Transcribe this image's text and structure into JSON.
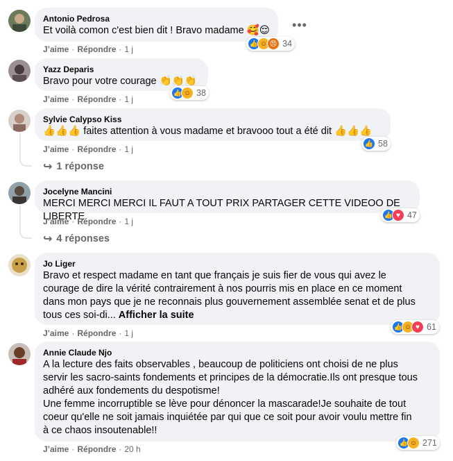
{
  "comments": [
    {
      "author": "Antonio Pedrosa",
      "text": "Et voilà comon c'est bien dit ! Bravo madame 🥰😌",
      "like_label": "J’aime",
      "reply_label": "Répondre",
      "time": "1 j",
      "reactions": [
        "like-icon",
        "care-icon",
        "angry-icon"
      ],
      "count": "34"
    },
    {
      "author": "Yazz Deparis",
      "text": "Bravo pour votre courage 👏👏👏",
      "like_label": "J’aime",
      "reply_label": "Répondre",
      "time": "1 j",
      "reactions": [
        "like-icon",
        "care-icon"
      ],
      "count": "38"
    },
    {
      "author": "Sylvie Calypso Kiss",
      "text": "👍👍👍 faites attention à vous madame et bravooo tout a été dit 👍👍👍",
      "like_label": "J’aime",
      "reply_label": "Répondre",
      "time": "1 j",
      "reactions": [
        "like-icon"
      ],
      "count": "58",
      "replies": "1 réponse"
    },
    {
      "author": "Jocelyne Mancini",
      "text": "MERCI MERCI MERCI IL FAUT A TOUT PRIX PARTAGER CETTE VIDEOO DE LIBERTE",
      "like_label": "J’aime",
      "reply_label": "Répondre",
      "time": "1 j",
      "reactions": [
        "like-icon",
        "love-icon"
      ],
      "count": "47",
      "replies": "4 réponses"
    },
    {
      "author": "Jo Liger",
      "text_lines": [
        "Bravo et respect madame en tant que français je suis fier de vous qui avez le",
        "courage de dire la vérité contrairement à nos pourris mis en place en ce moment",
        "dans mon pays que je ne reconnais plus gouvernement assemblée senat et de plus",
        "tous ces soi-di..."
      ],
      "more_label": "Afficher la suite",
      "like_label": "J’aime",
      "reply_label": "Répondre",
      "time": "1 j",
      "reactions": [
        "like-icon",
        "care-icon",
        "love-icon"
      ],
      "count": "61"
    },
    {
      "author": "Annie Claude Njo",
      "text_lines": [
        "A la lecture des faits observables , beaucoup de politiciens ont choisi de ne plus",
        "servir les sacro-saints fondements et principes de la démocratie.Ils ont presque tous",
        "adhéré aux fondements du despotisme!",
        "Une femme incorruptible se lève pour dénoncer la mascarade!Je souhaite de tout",
        "coeur qu'elle ne soit jamais inquiétée par qui que ce soit pour avoir voulu mettre fin",
        "à ce chaos insoutenable!!"
      ],
      "like_label": "J’aime",
      "reply_label": "Répondre",
      "time": "20 h",
      "reactions": [
        "like-icon",
        "care-icon"
      ],
      "count": "271"
    }
  ],
  "more_options_icon": "more-options-icon",
  "reply_arrow_icon": "reply-arrow-icon",
  "colors": {
    "bubble": "#f0f2f5",
    "meta_text": "#65676b",
    "like": "#1877f2",
    "love": "#f33e58",
    "care": "#f7b125",
    "angry": "#e9710f"
  }
}
